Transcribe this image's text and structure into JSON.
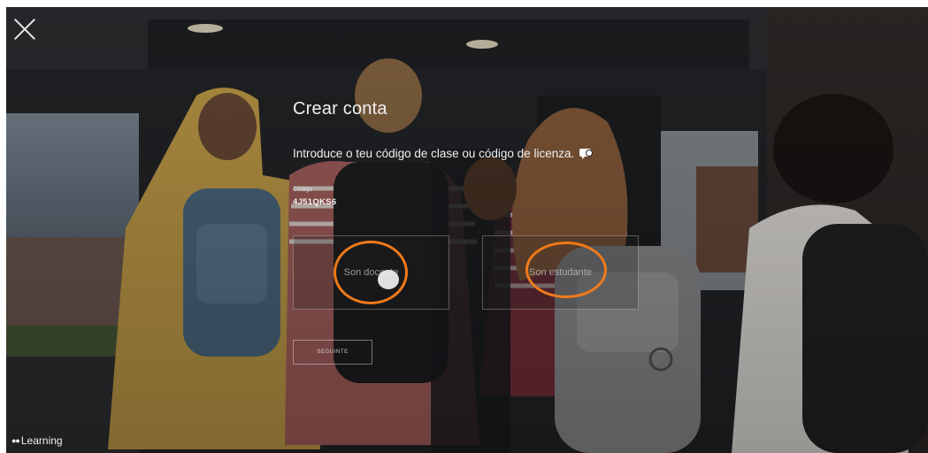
{
  "header": {
    "close_icon": "close-icon"
  },
  "form": {
    "title": "Crear conta",
    "prompt": "Introduce o teu código de clase ou código de licenza.",
    "help_icon": "chat-help-icon",
    "code_label": "Código",
    "code_value": "4J51QKS6"
  },
  "roles": {
    "teacher_label": "Son docente",
    "student_label": "Son estudante"
  },
  "actions": {
    "next_label": "SEGUINTE"
  },
  "brand": {
    "logo_text": "Learning"
  },
  "colors": {
    "annotation": "#f07a1a",
    "text": "#f0f0f0"
  }
}
